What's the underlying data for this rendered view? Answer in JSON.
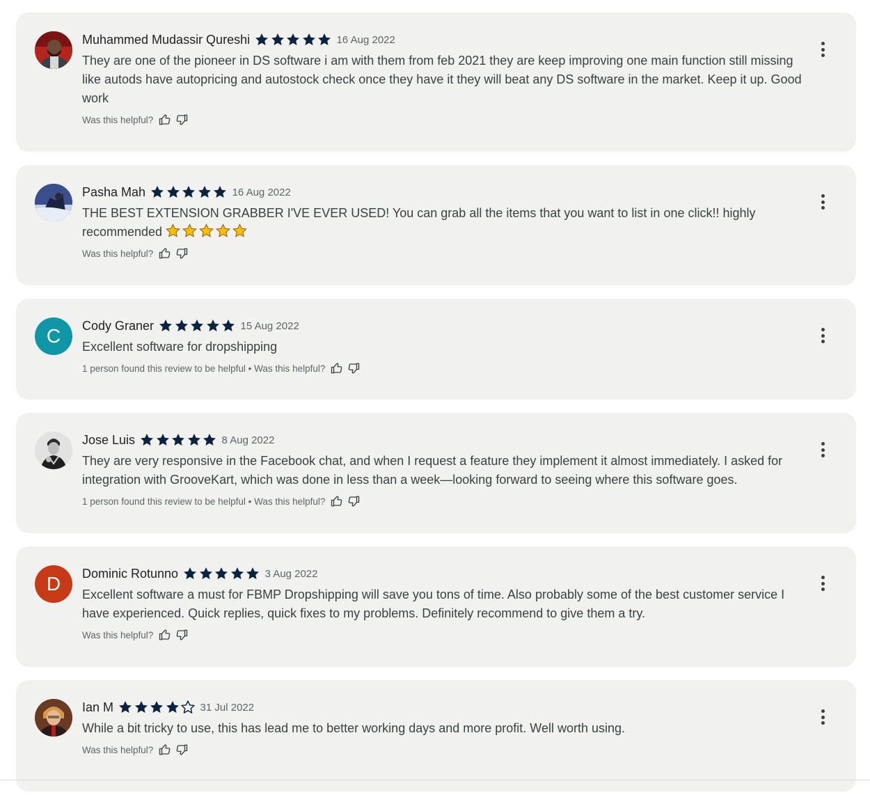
{
  "colors": {
    "card_background": "#f1f2f0",
    "star_fill": "#0b2340",
    "inline_star_fill": "#fbbc04",
    "avatar_c": "#0f97a8",
    "avatar_d": "#c63a16"
  },
  "reviews": [
    {
      "author": "Muhammed Mudassir Qureshi",
      "rating": 5,
      "date": "16 Aug 2022",
      "text": "They are one of the pioneer in DS software i am with them from feb 2021 they are keep improving one main function still missing like autods have autopricing and autostock check once they have it they will beat any DS software in the market. Keep it up. Good work",
      "helpful": "Was this helpful?",
      "avatar_icon": "profile-photo"
    },
    {
      "author": "Pasha Mah",
      "rating": 5,
      "date": "16 Aug 2022",
      "text": "THE BEST EXTENSION GRABBER I'VE EVER USED!  You can grab all the items that you want to list in one click!! highly recommended",
      "helpful": "Was this helpful?",
      "avatar_icon": "profile-photo"
    },
    {
      "author": "Cody Graner",
      "rating": 5,
      "date": "15 Aug 2022",
      "text": "Excellent software for dropshipping",
      "helpful": "1 person found this review to be helpful • Was this helpful?",
      "avatar_letter": "C"
    },
    {
      "author": "Jose Luis",
      "rating": 5,
      "date": "8 Aug 2022",
      "text": "They are very responsive in the Facebook chat, and when I request a feature they implement it almost immediately. I asked for integration with GrooveKart, which was done in less than a week—looking forward to seeing where this software goes.",
      "helpful": "1 person found this review to be helpful • Was this helpful?",
      "avatar_icon": "profile-photo"
    },
    {
      "author": "Dominic Rotunno",
      "rating": 5,
      "date": "3 Aug 2022",
      "text": "Excellent software a must for FBMP Dropshipping will save you tons of time. Also probably some of the best customer service I have experienced. Quick replies, quick fixes to my problems. Definitely recommend to give them a try.",
      "helpful": "Was this helpful?",
      "avatar_letter": "D"
    },
    {
      "author": "Ian M",
      "rating": 4,
      "date": "31 Jul 2022",
      "text": "While a bit tricky to use, this has lead me to better working days and more profit. Well worth using.",
      "helpful": "Was this helpful?",
      "avatar_icon": "profile-photo"
    }
  ]
}
